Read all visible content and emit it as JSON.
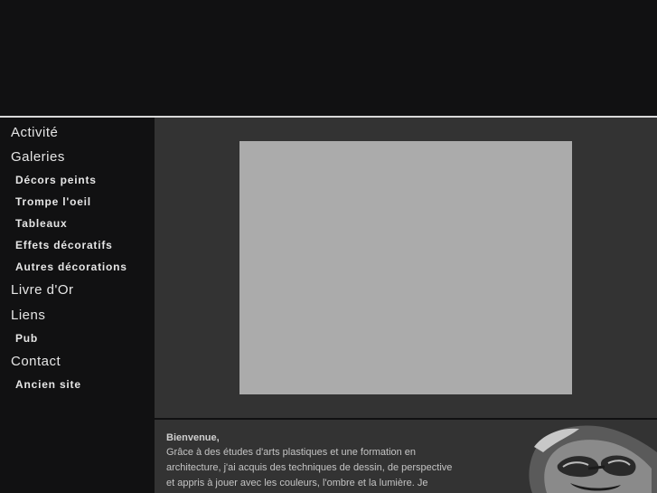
{
  "nav": {
    "activite": "Activité",
    "galeries": "Galeries",
    "decors_peints": "Décors peints",
    "trompe_loeil": "Trompe l'oeil",
    "tableaux": "Tableaux",
    "effets_decoratifs": "Effets décoratifs",
    "autres_decorations": "Autres décorations",
    "livre_dor": "Livre d'Or",
    "liens": "Liens",
    "pub": "Pub",
    "contact": "Contact",
    "ancien_site": "Ancien site"
  },
  "welcome": {
    "title": "Bienvenue,",
    "lines": [
      "Grâce à des études d'arts plastiques et une formation en",
      "architecture, j'ai acquis des techniques de dessin, de perspective",
      "et appris à jouer avec les couleurs, l'ombre et la lumière. Je"
    ]
  },
  "colors": {
    "background": "#111112",
    "panel": "#333333",
    "media_placeholder": "#ababab",
    "rule": "#d9d9d9",
    "nav_text": "#e6e6e6"
  }
}
